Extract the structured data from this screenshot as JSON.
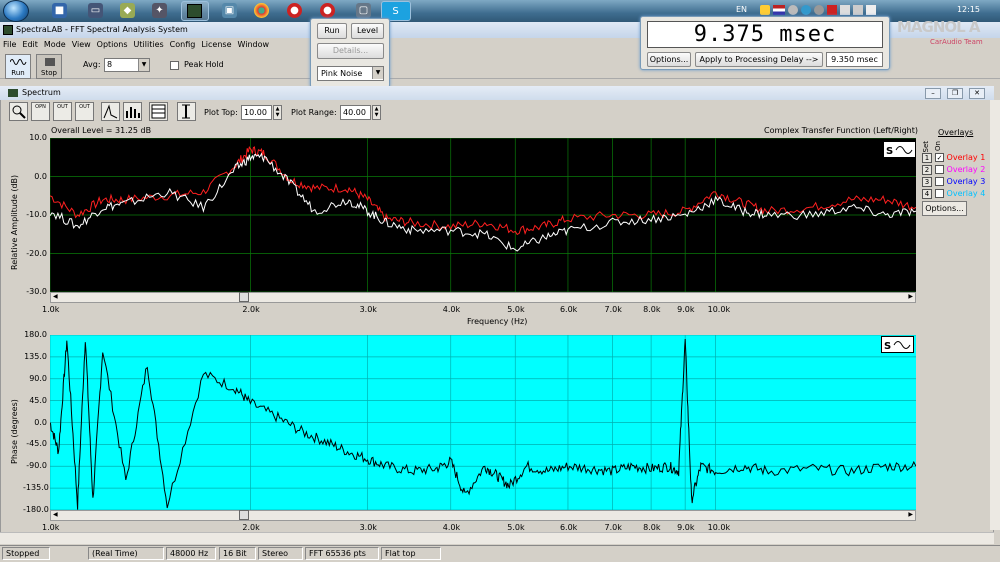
{
  "taskbar": {
    "language": "EN",
    "clock": "12:15",
    "icons": [
      "start-orb",
      "spectralab-icon",
      "monitor-icon",
      "folder-icon",
      "gear-icon",
      "app-icon",
      "chrome-icon",
      "record-icon",
      "record-icon",
      "window-icon",
      "skype-icon"
    ]
  },
  "window": {
    "title": "SpectraLAB - FFT Spectral Analysis System"
  },
  "menu": [
    "File",
    "Edit",
    "Mode",
    "View",
    "Options",
    "Utilities",
    "Config",
    "License",
    "Window"
  ],
  "toolbar": {
    "run_label": "Run",
    "stop_label": "Stop",
    "avg_label": "Avg:",
    "avg_value": "8",
    "peak_hold_label": "Peak Hold"
  },
  "run_panel": {
    "run_label": "Run",
    "level_label": "Level",
    "details_label": "Details...",
    "noise_value": "Pink Noise"
  },
  "delay_panel": {
    "display": "9.375 msec",
    "options_label": "Options...",
    "apply_label": "Apply to Processing Delay -->",
    "value": "9.350 msec"
  },
  "watermark": {
    "brand": "MAGNOL A",
    "team": "CarAudio Team"
  },
  "spectrum": {
    "title": "Spectrum",
    "plot_top_label": "Plot Top:",
    "plot_top_value": "10.00",
    "plot_range_label": "Plot Range:",
    "plot_range_value": "40.00",
    "overall_level": "Overall Level = 31.25 dB",
    "transfer_label": "Complex Transfer Function (Left/Right)",
    "overlays": {
      "title": "Overlays",
      "set_label": "Set",
      "on_label": "On",
      "items": [
        {
          "num": "1",
          "label": "Overlay 1",
          "checked": true,
          "color": "#ff0000"
        },
        {
          "num": "2",
          "label": "Overlay 2",
          "checked": false,
          "color": "#ff00ff"
        },
        {
          "num": "3",
          "label": "Overlay 3",
          "checked": false,
          "color": "#0000ff"
        },
        {
          "num": "4",
          "label": "Overlay 4",
          "checked": false,
          "color": "#00c0ff"
        }
      ],
      "options_label": "Options..."
    },
    "button_labels": [
      "OPN",
      "OUT",
      "OUT"
    ]
  },
  "chart_data": [
    {
      "type": "line",
      "ylabel": "Relative Amplitude (dB)",
      "xlabel": "Frequency (Hz)",
      "x_scale": "log",
      "xlim": [
        1000,
        20000
      ],
      "ylim": [
        -30,
        10
      ],
      "grid": true,
      "yticks": [
        "10.0",
        "0.0",
        "-10.0",
        "-20.0",
        "-30.0"
      ],
      "xticks": [
        "1.0k",
        "2.0k",
        "3.0k",
        "4.0k",
        "5.0k",
        "6.0k",
        "7.0k",
        "8.0k",
        "9.0k",
        "10.0k"
      ],
      "series": [
        {
          "color": "#ff2020",
          "x": [
            1000,
            1100,
            1200,
            1300,
            1500,
            1700,
            1900,
            2000,
            2100,
            2300,
            2500,
            2800,
            3000,
            3200,
            3500,
            4000,
            4500,
            5000,
            5500,
            6000,
            7000,
            8000,
            9000,
            10000,
            11000,
            12000,
            14000,
            16000,
            18000,
            20000
          ],
          "y": [
            -5,
            -10,
            -6,
            -6,
            -5,
            -4,
            3,
            7,
            6,
            -1,
            -3,
            -3,
            -6,
            -11,
            -12,
            -13,
            -12,
            -14,
            -13,
            -11,
            -10,
            -10,
            -9,
            -4,
            -7,
            -9,
            -8,
            -6,
            -6,
            -8
          ]
        },
        {
          "color": "#ffffff",
          "x": [
            1000,
            1100,
            1200,
            1300,
            1500,
            1700,
            1900,
            2000,
            2100,
            2300,
            2500,
            2800,
            3000,
            3200,
            3500,
            4000,
            4500,
            5000,
            5500,
            6000,
            7000,
            8000,
            9000,
            10000,
            11000,
            12000,
            14000,
            16000,
            18000,
            20000
          ],
          "y": [
            -9,
            -13,
            -8,
            -7,
            -4,
            -8,
            2,
            5,
            5,
            -2,
            -9,
            -6,
            -9,
            -12,
            -14,
            -14,
            -15,
            -19,
            -16,
            -14,
            -12,
            -11,
            -10,
            -6,
            -9,
            -10,
            -10,
            -8,
            -10,
            -9
          ]
        }
      ]
    },
    {
      "type": "line",
      "ylabel": "Phase (degrees)",
      "x_scale": "log",
      "xlim": [
        1000,
        20000
      ],
      "ylim": [
        -180,
        180
      ],
      "grid": true,
      "yticks": [
        "180.0",
        "135.0",
        "90.0",
        "45.0",
        "0.0",
        "-45.0",
        "-90.0",
        "-135.0",
        "-180.0"
      ],
      "xticks": [
        "1.0k",
        "2.0k",
        "3.0k",
        "4.0k",
        "5.0k",
        "6.0k",
        "7.0k",
        "8.0k",
        "9.0k",
        "10.0k"
      ],
      "series": [
        {
          "color": "#000000",
          "x": [
            1000,
            1030,
            1060,
            1100,
            1130,
            1160,
            1200,
            1300,
            1400,
            1500,
            1700,
            1900,
            2000,
            2200,
            2400,
            2600,
            2800,
            3000,
            3200,
            3500,
            3800,
            4000,
            4200,
            4500,
            4700,
            4900,
            5200,
            5600,
            6000,
            6500,
            7000,
            7500,
            8000,
            8500,
            8800,
            9000,
            9200,
            9500,
            10000,
            11000,
            12000,
            14000,
            16000,
            18000,
            20000
          ],
          "y": [
            0,
            -60,
            170,
            -170,
            175,
            -160,
            150,
            -120,
            120,
            -170,
            100,
            70,
            40,
            10,
            -20,
            -40,
            -60,
            -75,
            -90,
            -100,
            -95,
            -80,
            -150,
            -90,
            -110,
            -130,
            -90,
            -100,
            -90,
            -95,
            -100,
            -90,
            -95,
            -90,
            -100,
            170,
            -160,
            -90,
            -100,
            -90,
            -100,
            -95,
            -100,
            -90,
            -90
          ]
        }
      ]
    }
  ],
  "status": {
    "state": "Stopped",
    "mode": "(Real Time)",
    "rate": "48000 Hz",
    "bits": "16 Bit",
    "channels": "Stereo",
    "fft": "FFT 65536 pts",
    "window": "Flat top"
  }
}
